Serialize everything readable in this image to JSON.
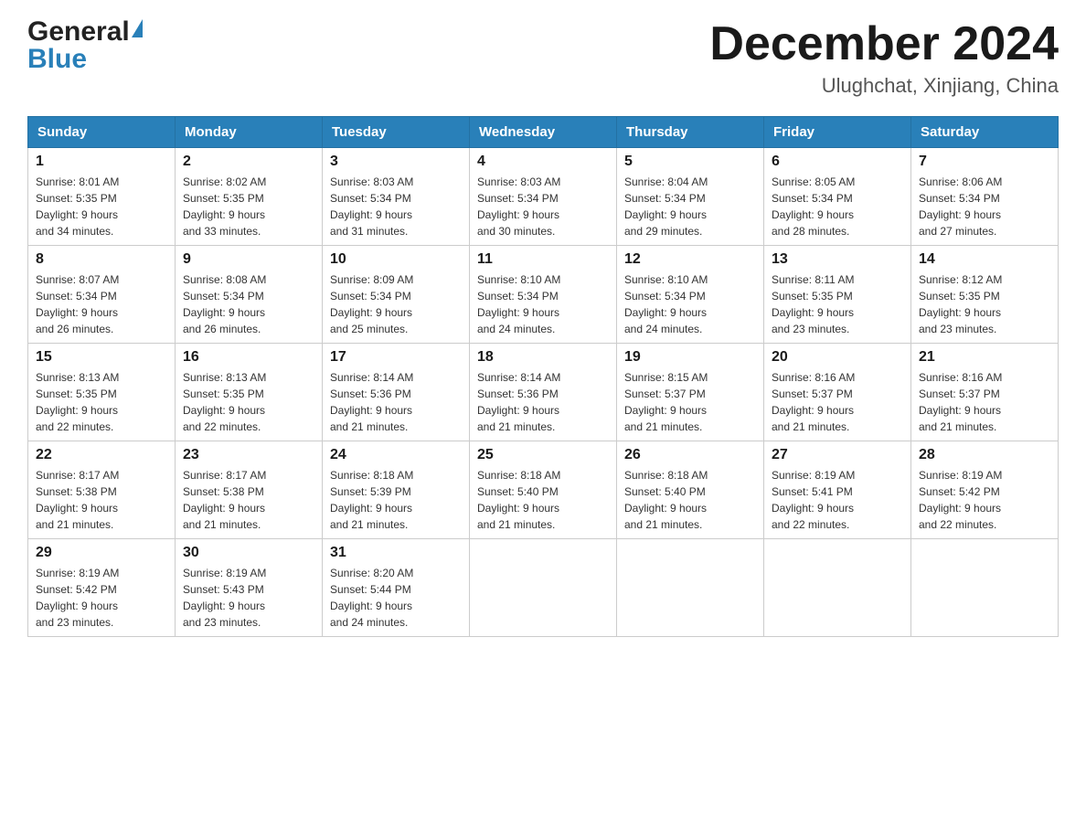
{
  "logo": {
    "general": "General",
    "blue": "Blue"
  },
  "title": "December 2024",
  "subtitle": "Ulughchat, Xinjiang, China",
  "days_of_week": [
    "Sunday",
    "Monday",
    "Tuesday",
    "Wednesday",
    "Thursday",
    "Friday",
    "Saturday"
  ],
  "weeks": [
    [
      {
        "day": "1",
        "sunrise": "Sunrise: 8:01 AM",
        "sunset": "Sunset: 5:35 PM",
        "daylight": "Daylight: 9 hours",
        "daylight2": "and 34 minutes."
      },
      {
        "day": "2",
        "sunrise": "Sunrise: 8:02 AM",
        "sunset": "Sunset: 5:35 PM",
        "daylight": "Daylight: 9 hours",
        "daylight2": "and 33 minutes."
      },
      {
        "day": "3",
        "sunrise": "Sunrise: 8:03 AM",
        "sunset": "Sunset: 5:34 PM",
        "daylight": "Daylight: 9 hours",
        "daylight2": "and 31 minutes."
      },
      {
        "day": "4",
        "sunrise": "Sunrise: 8:03 AM",
        "sunset": "Sunset: 5:34 PM",
        "daylight": "Daylight: 9 hours",
        "daylight2": "and 30 minutes."
      },
      {
        "day": "5",
        "sunrise": "Sunrise: 8:04 AM",
        "sunset": "Sunset: 5:34 PM",
        "daylight": "Daylight: 9 hours",
        "daylight2": "and 29 minutes."
      },
      {
        "day": "6",
        "sunrise": "Sunrise: 8:05 AM",
        "sunset": "Sunset: 5:34 PM",
        "daylight": "Daylight: 9 hours",
        "daylight2": "and 28 minutes."
      },
      {
        "day": "7",
        "sunrise": "Sunrise: 8:06 AM",
        "sunset": "Sunset: 5:34 PM",
        "daylight": "Daylight: 9 hours",
        "daylight2": "and 27 minutes."
      }
    ],
    [
      {
        "day": "8",
        "sunrise": "Sunrise: 8:07 AM",
        "sunset": "Sunset: 5:34 PM",
        "daylight": "Daylight: 9 hours",
        "daylight2": "and 26 minutes."
      },
      {
        "day": "9",
        "sunrise": "Sunrise: 8:08 AM",
        "sunset": "Sunset: 5:34 PM",
        "daylight": "Daylight: 9 hours",
        "daylight2": "and 26 minutes."
      },
      {
        "day": "10",
        "sunrise": "Sunrise: 8:09 AM",
        "sunset": "Sunset: 5:34 PM",
        "daylight": "Daylight: 9 hours",
        "daylight2": "and 25 minutes."
      },
      {
        "day": "11",
        "sunrise": "Sunrise: 8:10 AM",
        "sunset": "Sunset: 5:34 PM",
        "daylight": "Daylight: 9 hours",
        "daylight2": "and 24 minutes."
      },
      {
        "day": "12",
        "sunrise": "Sunrise: 8:10 AM",
        "sunset": "Sunset: 5:34 PM",
        "daylight": "Daylight: 9 hours",
        "daylight2": "and 24 minutes."
      },
      {
        "day": "13",
        "sunrise": "Sunrise: 8:11 AM",
        "sunset": "Sunset: 5:35 PM",
        "daylight": "Daylight: 9 hours",
        "daylight2": "and 23 minutes."
      },
      {
        "day": "14",
        "sunrise": "Sunrise: 8:12 AM",
        "sunset": "Sunset: 5:35 PM",
        "daylight": "Daylight: 9 hours",
        "daylight2": "and 23 minutes."
      }
    ],
    [
      {
        "day": "15",
        "sunrise": "Sunrise: 8:13 AM",
        "sunset": "Sunset: 5:35 PM",
        "daylight": "Daylight: 9 hours",
        "daylight2": "and 22 minutes."
      },
      {
        "day": "16",
        "sunrise": "Sunrise: 8:13 AM",
        "sunset": "Sunset: 5:35 PM",
        "daylight": "Daylight: 9 hours",
        "daylight2": "and 22 minutes."
      },
      {
        "day": "17",
        "sunrise": "Sunrise: 8:14 AM",
        "sunset": "Sunset: 5:36 PM",
        "daylight": "Daylight: 9 hours",
        "daylight2": "and 21 minutes."
      },
      {
        "day": "18",
        "sunrise": "Sunrise: 8:14 AM",
        "sunset": "Sunset: 5:36 PM",
        "daylight": "Daylight: 9 hours",
        "daylight2": "and 21 minutes."
      },
      {
        "day": "19",
        "sunrise": "Sunrise: 8:15 AM",
        "sunset": "Sunset: 5:37 PM",
        "daylight": "Daylight: 9 hours",
        "daylight2": "and 21 minutes."
      },
      {
        "day": "20",
        "sunrise": "Sunrise: 8:16 AM",
        "sunset": "Sunset: 5:37 PM",
        "daylight": "Daylight: 9 hours",
        "daylight2": "and 21 minutes."
      },
      {
        "day": "21",
        "sunrise": "Sunrise: 8:16 AM",
        "sunset": "Sunset: 5:37 PM",
        "daylight": "Daylight: 9 hours",
        "daylight2": "and 21 minutes."
      }
    ],
    [
      {
        "day": "22",
        "sunrise": "Sunrise: 8:17 AM",
        "sunset": "Sunset: 5:38 PM",
        "daylight": "Daylight: 9 hours",
        "daylight2": "and 21 minutes."
      },
      {
        "day": "23",
        "sunrise": "Sunrise: 8:17 AM",
        "sunset": "Sunset: 5:38 PM",
        "daylight": "Daylight: 9 hours",
        "daylight2": "and 21 minutes."
      },
      {
        "day": "24",
        "sunrise": "Sunrise: 8:18 AM",
        "sunset": "Sunset: 5:39 PM",
        "daylight": "Daylight: 9 hours",
        "daylight2": "and 21 minutes."
      },
      {
        "day": "25",
        "sunrise": "Sunrise: 8:18 AM",
        "sunset": "Sunset: 5:40 PM",
        "daylight": "Daylight: 9 hours",
        "daylight2": "and 21 minutes."
      },
      {
        "day": "26",
        "sunrise": "Sunrise: 8:18 AM",
        "sunset": "Sunset: 5:40 PM",
        "daylight": "Daylight: 9 hours",
        "daylight2": "and 21 minutes."
      },
      {
        "day": "27",
        "sunrise": "Sunrise: 8:19 AM",
        "sunset": "Sunset: 5:41 PM",
        "daylight": "Daylight: 9 hours",
        "daylight2": "and 22 minutes."
      },
      {
        "day": "28",
        "sunrise": "Sunrise: 8:19 AM",
        "sunset": "Sunset: 5:42 PM",
        "daylight": "Daylight: 9 hours",
        "daylight2": "and 22 minutes."
      }
    ],
    [
      {
        "day": "29",
        "sunrise": "Sunrise: 8:19 AM",
        "sunset": "Sunset: 5:42 PM",
        "daylight": "Daylight: 9 hours",
        "daylight2": "and 23 minutes."
      },
      {
        "day": "30",
        "sunrise": "Sunrise: 8:19 AM",
        "sunset": "Sunset: 5:43 PM",
        "daylight": "Daylight: 9 hours",
        "daylight2": "and 23 minutes."
      },
      {
        "day": "31",
        "sunrise": "Sunrise: 8:20 AM",
        "sunset": "Sunset: 5:44 PM",
        "daylight": "Daylight: 9 hours",
        "daylight2": "and 24 minutes."
      },
      null,
      null,
      null,
      null
    ]
  ]
}
